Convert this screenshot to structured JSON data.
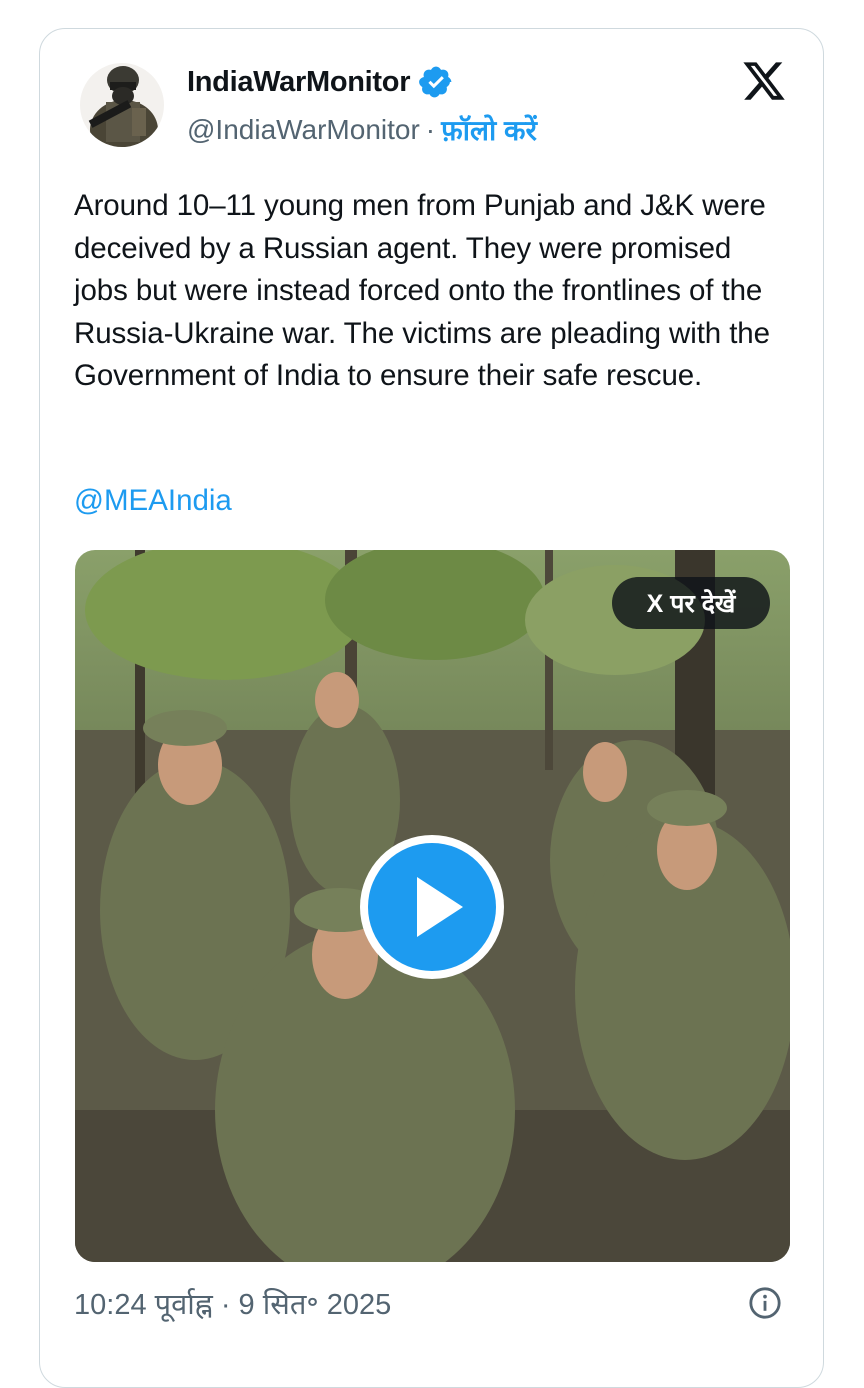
{
  "tweet": {
    "display_name": "IndiaWarMonitor",
    "handle": "@IndiaWarMonitor",
    "separator": "·",
    "follow_label": "फ़ॉलो करें",
    "text": "Around 10–11 young men from Punjab and J&K were deceived by a Russian agent. They were promised jobs but were instead forced onto the frontlines of the Russia-Ukraine war. The victims are pleading with the Government of India to ensure their safe rescue.",
    "mention": "@MEAIndia",
    "timestamp": "10:24 पूर्वाह्न · 9 सित॰ 2025"
  },
  "media": {
    "watch_label": "X पर देखें",
    "play_icon": "play-icon"
  },
  "icons": {
    "verified": "verified-badge-icon",
    "platform": "x-logo-icon",
    "info": "info-icon"
  },
  "colors": {
    "accent": "#1d9bf0",
    "text": "#0f1419",
    "secondary": "#536471",
    "border": "#cfd9de"
  }
}
